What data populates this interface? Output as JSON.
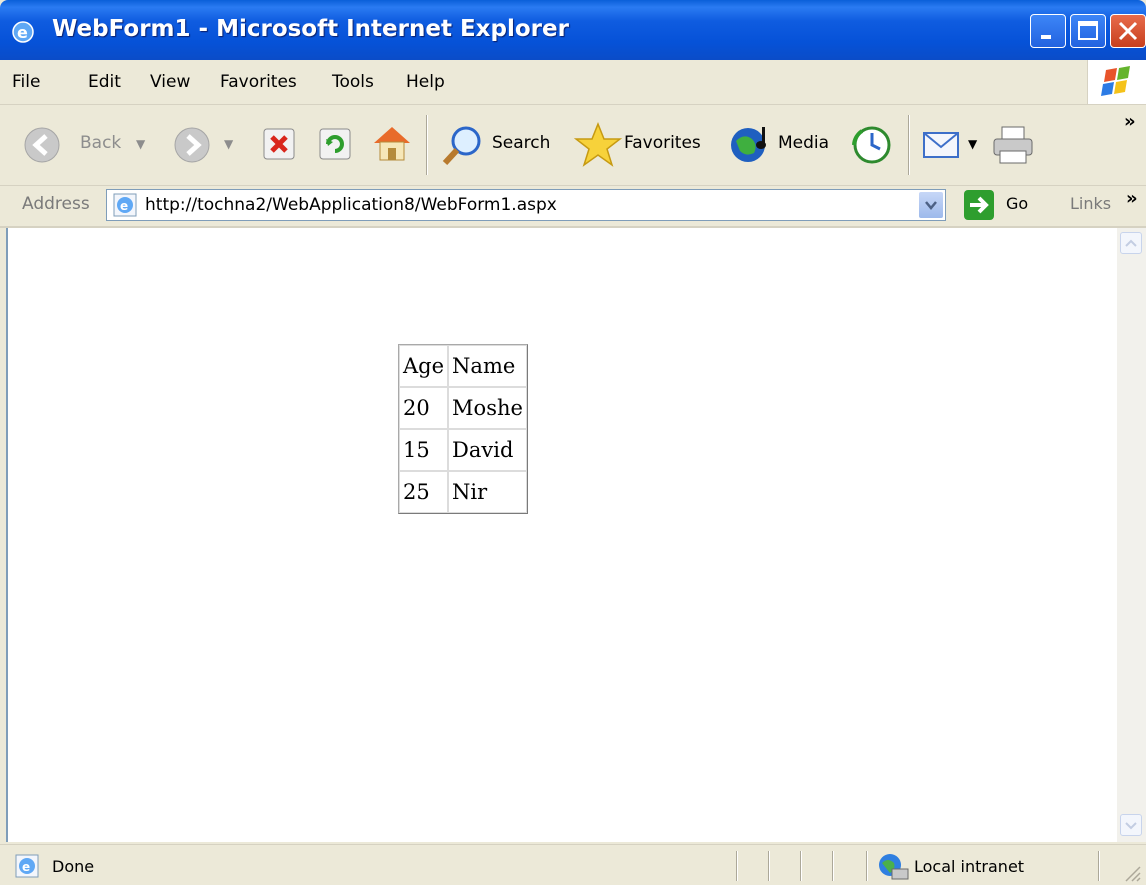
{
  "window": {
    "title": "WebForm1 - Microsoft Internet Explorer"
  },
  "menu": {
    "items": [
      "File",
      "Edit",
      "View",
      "Favorites",
      "Tools",
      "Help"
    ]
  },
  "toolbar": {
    "back_label": "Back",
    "search_label": "Search",
    "favorites_label": "Favorites",
    "media_label": "Media",
    "chevron": "»"
  },
  "address": {
    "label": "Address",
    "url": "http://tochna2/WebApplication8/WebForm1.aspx",
    "go_label": "Go",
    "links_label": "Links"
  },
  "table": {
    "headers": [
      "Age",
      "Name"
    ],
    "rows": [
      [
        "20",
        "Moshe"
      ],
      [
        "15",
        "David"
      ],
      [
        "25",
        "Nir"
      ]
    ]
  },
  "status": {
    "text": "Done",
    "zone": "Local intranet"
  },
  "colors": {
    "titlebar": "#0A5FD9",
    "chrome": "#ECE9D8",
    "page": "#FFFFFF"
  }
}
